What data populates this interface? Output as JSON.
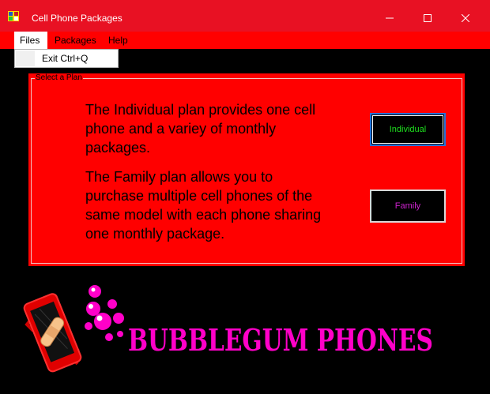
{
  "window": {
    "title": "Cell Phone Packages",
    "controls": {
      "minimize": "minimize-icon",
      "maximize": "maximize-icon",
      "close": "close-icon"
    },
    "accent": "#e81123"
  },
  "menubar": {
    "items": [
      {
        "label": "Files",
        "open": true
      },
      {
        "label": "Packages"
      },
      {
        "label": "Help"
      }
    ],
    "dropdown": {
      "items": [
        {
          "label": "Exit Ctrl+Q"
        }
      ]
    }
  },
  "group": {
    "title": "Select a Plan",
    "individual_text": "The Individual plan provides one cell phone and a variey of monthly packages.",
    "family_text": "The Family plan allows you to purchase multiple cell phones of the same model with each phone sharing one monthly package."
  },
  "buttons": {
    "individual": "Individual",
    "family": "Family"
  },
  "branding": {
    "name": "BUBBLEGUM PHONES",
    "color": "#ff00c8"
  }
}
